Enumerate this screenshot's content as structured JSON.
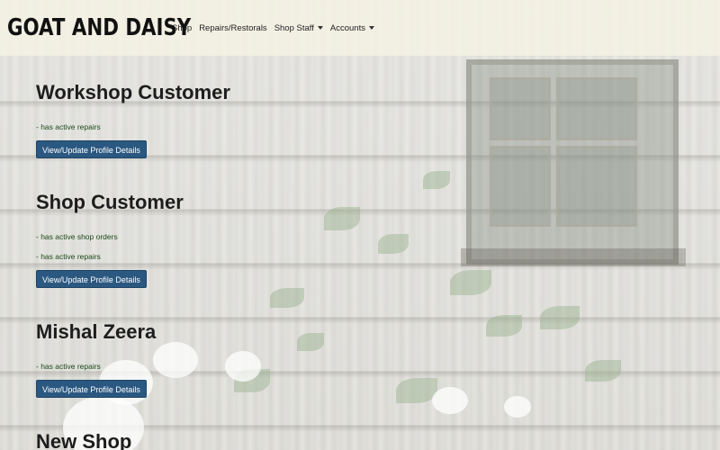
{
  "navbar": {
    "brand": "GOAT AND DAISY",
    "links": [
      {
        "label": "Shop",
        "dropdown": false
      },
      {
        "label": "Repairs/Restorals",
        "dropdown": false
      },
      {
        "label": "Shop Staff",
        "dropdown": true
      },
      {
        "label": "Accounts",
        "dropdown": true
      }
    ]
  },
  "customers": [
    {
      "name": "Workshop Customer",
      "statuses": [
        "- has active repairs"
      ],
      "button_label": "View/Update Profile Details"
    },
    {
      "name": "Shop Customer",
      "statuses": [
        "- has active shop orders",
        "- has active repairs"
      ],
      "button_label": "View/Update Profile Details"
    },
    {
      "name": "Mishal Zeera",
      "statuses": [
        "- has active repairs"
      ],
      "button_label": "View/Update Profile Details"
    },
    {
      "name": "New Shop",
      "statuses": [],
      "button_label": ""
    }
  ],
  "colors": {
    "button_bg": "#2b5880",
    "status_text": "#1c4a1a",
    "navbar_bg": "#f5f2e4"
  }
}
